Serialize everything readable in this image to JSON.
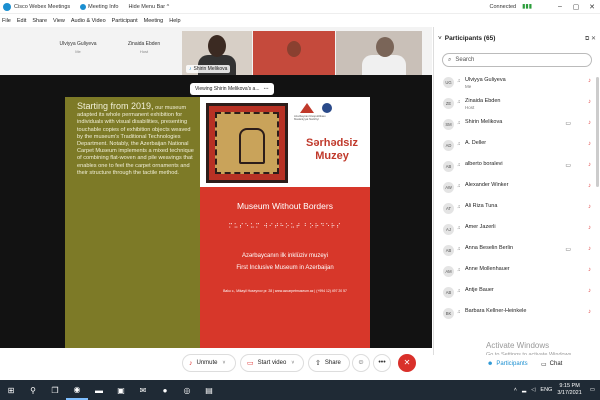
{
  "titlebar": {
    "app_title": "Cisco Webex Meetings",
    "meeting_info": "Meeting Info",
    "hide_menu": "Hide Menu Bar",
    "hide_menu_chevron": "^",
    "status": "Connected",
    "minimize": "–",
    "maximize": "▢",
    "close": "✕"
  },
  "menu": [
    "File",
    "Edit",
    "Share",
    "View",
    "Audio & Video",
    "Participant",
    "Meeting",
    "Help"
  ],
  "strip": {
    "thumb1": {
      "name": "Ulviyya Guliyeva",
      "role": "Me"
    },
    "thumb2": {
      "name": "Zinaida Ebden",
      "role": "Host"
    },
    "video_label": "Shirin Melikova"
  },
  "stage": {
    "viewing": "Viewing Shirin Melikova's a..."
  },
  "slide": {
    "lead": "Starting from 2019,",
    "body": " our museum adapted its whole permanent exhibition for individuals with visual disabilities, presenting touchable copies of exhibition objects weaved by the museum's Traditional Technologies Department. Notably, the Azerbaijan National Carpet Museum implements a mixed technique of combining flat-woven and pile weavings that enables one to feel the carpet ornaments and their structure through the tactile method.",
    "logo_text": "Azərbaycan Respublikası Mədəniyyət Nazirliyi",
    "sarh_1": "Sərhədsiz",
    "sarh_2": "Muzey",
    "mwb": "Museum Without Borders",
    "braille": "⠍⠥⠎⠑⠥⠍ ⠺⠊⠞⠓⠕⠥⠞ ⠃⠕⠗⠙⠑⠗⠎",
    "az_line1": "Azərbaycanın ilk inklüziv muzeyi",
    "az_line2": "First Inclusive Museum in Azerbaijan",
    "address": "Baku c., Mikayil Huseynov pr. 28  |  www.azcarpetmuseum.az  |  (+994 12) 497 20 57"
  },
  "controls": {
    "unmute": "Unmute",
    "start_video": "Start video",
    "share": "Share",
    "react_icon": "☺",
    "more_icon": "•••",
    "end_icon": "✕"
  },
  "participants": {
    "header": "Participants (65)",
    "search_placeholder": "Search",
    "list": [
      {
        "initials": "UG",
        "name": "Ulviyya Guliyeva",
        "role": "Me",
        "camera": false
      },
      {
        "initials": "ZE",
        "name": "Zinaida Ebden",
        "role": "Host",
        "camera": false
      },
      {
        "initials": "SM",
        "name": "Shirin Melikova",
        "role": "",
        "camera": true
      },
      {
        "initials": "AD",
        "name": "A. Deller",
        "role": "",
        "camera": false
      },
      {
        "initials": "AB",
        "name": "alberto boralevi",
        "role": "",
        "camera": true
      },
      {
        "initials": "AW",
        "name": "Alexander Winker",
        "role": "",
        "camera": false
      },
      {
        "initials": "AT",
        "name": "Ali Riza Tuna",
        "role": "",
        "camera": false
      },
      {
        "initials": "AJ",
        "name": "Amer Jazerli",
        "role": "",
        "camera": false
      },
      {
        "initials": "AB",
        "name": "Anna Beselin Berlin",
        "role": "",
        "camera": true
      },
      {
        "initials": "AM",
        "name": "Anne Mollenhauer",
        "role": "",
        "camera": false
      },
      {
        "initials": "AB",
        "name": "Antje Bauer",
        "role": "",
        "camera": false
      },
      {
        "initials": "BK",
        "name": "Barbara Kellner-Heinkele",
        "role": "",
        "camera": false
      }
    ],
    "btn_participants": "Participants",
    "btn_chat": "Chat"
  },
  "activate": {
    "title": "Activate Windows",
    "subtitle": "Go to Settings to activate Windows."
  },
  "taskbar": {
    "lang": "ENG",
    "time": "9:15 PM",
    "date": "3/17/2021"
  },
  "colors": {
    "accent": "#1a8fd1",
    "slide_bg": "#7d7a27",
    "poster_red": "#d7372a",
    "end_red": "#d9302a",
    "taskbar": "#1f2a35"
  }
}
